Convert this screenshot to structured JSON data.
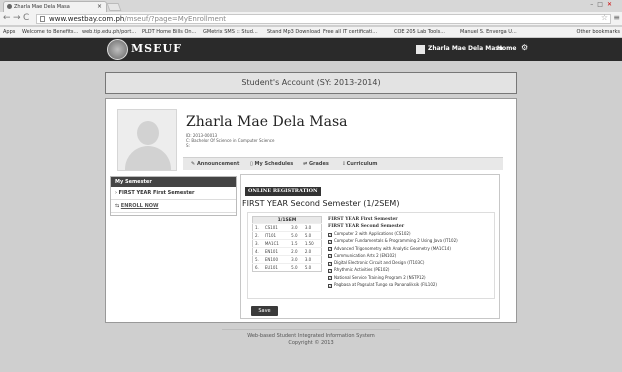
{
  "browser": {
    "tab_title": "Zharla Mae Dela Masa",
    "url_host": "www.westbay.com.ph",
    "url_path": "/mseuf/?page=MyEnrollment",
    "bookmarks": [
      "Apps",
      "Welcome to Benefits...",
      "web.tip.edu.ph/port...",
      "PLDT Home Bills On...",
      "GMetrix SMS :: Stud...",
      "Stand Mp3 Download",
      "Free all IT certificati...",
      "COE 205 Lab Tools...",
      "Manuel S. Enverga U..."
    ],
    "other_bookmarks": "Other bookmarks"
  },
  "site": {
    "brand": "MSEUF",
    "user_name": "Zharla Mae Dela Masa",
    "home": "Home"
  },
  "page_title": "Student's Account (SY: 2013-2014)",
  "student": {
    "name": "Zharla Mae Dela Masa",
    "id": "ID: 2013-00013",
    "course": "C: Bachelor Of Science in Computer Science",
    "year": "S:"
  },
  "tabs": [
    "Announcement",
    "My Schedules",
    "Grades",
    "Curriculum"
  ],
  "sidebar": {
    "heading": "My Semester",
    "items": [
      "FIRST YEAR First Semester",
      "ENROLL NOW"
    ]
  },
  "registration": {
    "badge": "ONLINE REGISTRATION",
    "semester_title": "FIRST YEAR Second Semester (1/2SEM)",
    "table_header": "1/1SEM",
    "rows": [
      {
        "no": "1.",
        "code": "CS101",
        "u1": "3.0",
        "u2": "3.0"
      },
      {
        "no": "2.",
        "code": "IT101",
        "u1": "5.0",
        "u2": "5.0"
      },
      {
        "no": "3.",
        "code": "MA1C1",
        "u1": "1.5",
        "u2": "1.50"
      },
      {
        "no": "4.",
        "code": "EN101",
        "u1": "2.0",
        "u2": "2.0"
      },
      {
        "no": "5.",
        "code": "EN100",
        "u1": "3.0",
        "u2": "3.0"
      },
      {
        "no": "6.",
        "code": "EU101",
        "u1": "5.0",
        "u2": "5.0"
      }
    ],
    "sub_heading_1": "FIRST YEAR First Semester",
    "sub_heading_2": "FIRST YEAR Second Semester",
    "subjects": [
      "Computer 2 with Applications (CS102)",
      "Computer Fundamentals & Programming 2 Using Java (IT102)",
      "Advanced Trigonometry with Analytic Geometry (MA1C14)",
      "Communication Arts 2 (EN102)",
      "Digital Electronic Circuit and Design (IT103C)",
      "Rhythmic Activities (PE102)",
      "National Service Training Program 2 (NSTP12)",
      "Pagbasa at Pagsulat Tungo sa Pananaliksik (FIL102)"
    ],
    "save": "Save"
  },
  "footer": {
    "line1": "Web-based Student Integrated Information System",
    "line2": "Copyright © 2013"
  }
}
